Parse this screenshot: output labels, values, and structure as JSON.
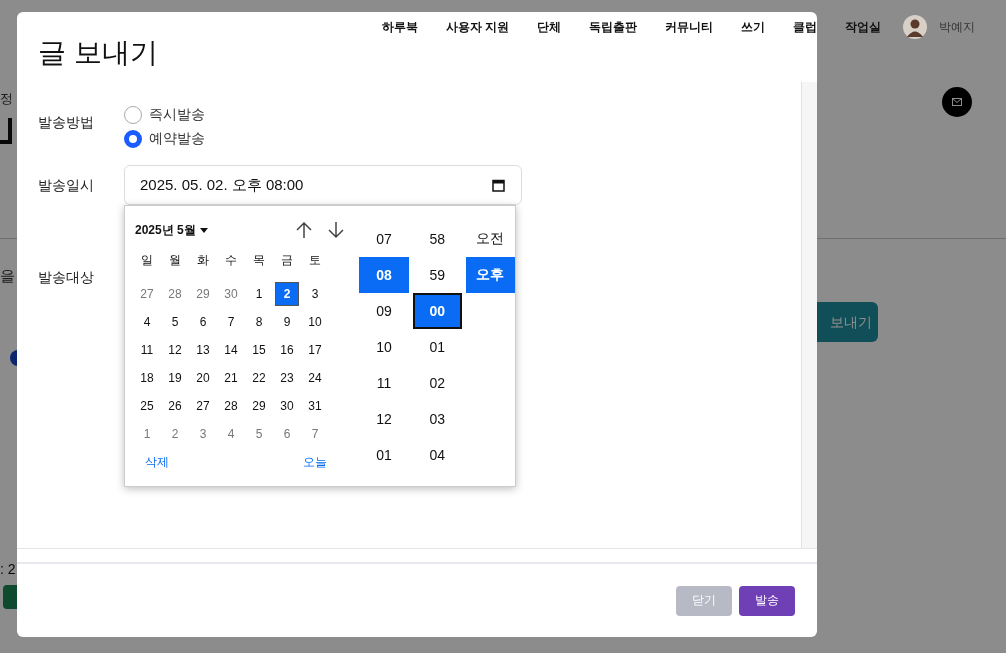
{
  "background": {
    "breadcrumb": "정",
    "text_fragment": "을",
    "date_fragment": ": 2",
    "action_button": "보내기"
  },
  "nav": {
    "items": [
      "하루북",
      "사용자 지원",
      "단체",
      "독립출판",
      "커뮤니티",
      "쓰기",
      "클럽",
      "작업실"
    ],
    "user": {
      "name": "박예지"
    }
  },
  "modal": {
    "title": "글 보내기",
    "method": {
      "label": "발송방법",
      "options": [
        {
          "label": "즉시발송",
          "selected": false
        },
        {
          "label": "예약발송",
          "selected": true
        }
      ]
    },
    "datetime": {
      "label": "발송일시",
      "value": "2025. 05. 02. 오후 08:00"
    },
    "target": {
      "label": "발송대상"
    },
    "picker": {
      "month_label": "2025년 5월",
      "weekdays": [
        "일",
        "월",
        "화",
        "수",
        "목",
        "금",
        "토"
      ],
      "days": [
        {
          "text": "27",
          "outside": true,
          "selected": false
        },
        {
          "text": "28",
          "outside": true,
          "selected": false
        },
        {
          "text": "29",
          "outside": true,
          "selected": false
        },
        {
          "text": "30",
          "outside": true,
          "selected": false
        },
        {
          "text": "1",
          "outside": false,
          "selected": false
        },
        {
          "text": "2",
          "outside": false,
          "selected": true
        },
        {
          "text": "3",
          "outside": false,
          "selected": false
        },
        {
          "text": "4",
          "outside": false,
          "selected": false
        },
        {
          "text": "5",
          "outside": false,
          "selected": false
        },
        {
          "text": "6",
          "outside": false,
          "selected": false
        },
        {
          "text": "7",
          "outside": false,
          "selected": false
        },
        {
          "text": "8",
          "outside": false,
          "selected": false
        },
        {
          "text": "9",
          "outside": false,
          "selected": false
        },
        {
          "text": "10",
          "outside": false,
          "selected": false
        },
        {
          "text": "11",
          "outside": false,
          "selected": false
        },
        {
          "text": "12",
          "outside": false,
          "selected": false
        },
        {
          "text": "13",
          "outside": false,
          "selected": false
        },
        {
          "text": "14",
          "outside": false,
          "selected": false
        },
        {
          "text": "15",
          "outside": false,
          "selected": false
        },
        {
          "text": "16",
          "outside": false,
          "selected": false
        },
        {
          "text": "17",
          "outside": false,
          "selected": false
        },
        {
          "text": "18",
          "outside": false,
          "selected": false
        },
        {
          "text": "19",
          "outside": false,
          "selected": false
        },
        {
          "text": "20",
          "outside": false,
          "selected": false
        },
        {
          "text": "21",
          "outside": false,
          "selected": false
        },
        {
          "text": "22",
          "outside": false,
          "selected": false
        },
        {
          "text": "23",
          "outside": false,
          "selected": false
        },
        {
          "text": "24",
          "outside": false,
          "selected": false
        },
        {
          "text": "25",
          "outside": false,
          "selected": false
        },
        {
          "text": "26",
          "outside": false,
          "selected": false
        },
        {
          "text": "27",
          "outside": false,
          "selected": false
        },
        {
          "text": "28",
          "outside": false,
          "selected": false
        },
        {
          "text": "29",
          "outside": false,
          "selected": false
        },
        {
          "text": "30",
          "outside": false,
          "selected": false
        },
        {
          "text": "31",
          "outside": false,
          "selected": false
        },
        {
          "text": "1",
          "outside": true,
          "selected": false
        },
        {
          "text": "2",
          "outside": true,
          "selected": false
        },
        {
          "text": "3",
          "outside": true,
          "selected": false
        },
        {
          "text": "4",
          "outside": true,
          "selected": false
        },
        {
          "text": "5",
          "outside": true,
          "selected": false
        },
        {
          "text": "6",
          "outside": true,
          "selected": false
        },
        {
          "text": "7",
          "outside": true,
          "selected": false
        }
      ],
      "clear": "삭제",
      "today": "오늘",
      "hours": [
        {
          "text": "07",
          "selected": false
        },
        {
          "text": "08",
          "selected": true
        },
        {
          "text": "09",
          "selected": false
        },
        {
          "text": "10",
          "selected": false
        },
        {
          "text": "11",
          "selected": false
        },
        {
          "text": "12",
          "selected": false
        },
        {
          "text": "01",
          "selected": false
        }
      ],
      "minutes": [
        {
          "text": "58",
          "selected": false,
          "focused": false
        },
        {
          "text": "59",
          "selected": false,
          "focused": false
        },
        {
          "text": "00",
          "selected": true,
          "focused": true
        },
        {
          "text": "01",
          "selected": false,
          "focused": false
        },
        {
          "text": "02",
          "selected": false,
          "focused": false
        },
        {
          "text": "03",
          "selected": false,
          "focused": false
        },
        {
          "text": "04",
          "selected": false,
          "focused": false
        }
      ],
      "ampm": [
        {
          "text": "오전",
          "selected": false
        },
        {
          "text": "오후",
          "selected": true
        }
      ]
    },
    "buttons": [
      {
        "label": "닫기",
        "kind": "secondary"
      },
      {
        "label": "발송",
        "kind": "primary"
      }
    ]
  }
}
